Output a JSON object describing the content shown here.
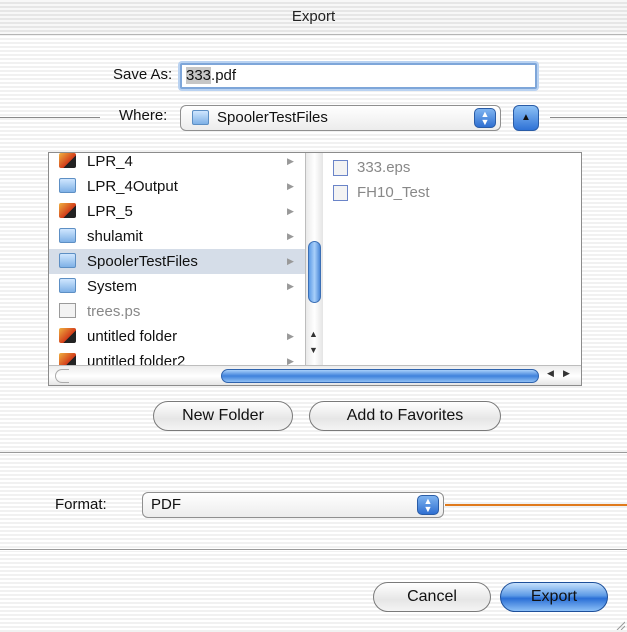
{
  "window": {
    "title": "Export"
  },
  "save_as": {
    "label": "Save As:",
    "value_selected": "333",
    "value_rest": ".pdf"
  },
  "where": {
    "label": "Where:",
    "selected": "SpoolerTestFiles"
  },
  "browser": {
    "column1": [
      {
        "name": "LPR_4",
        "icon": "red-folder-icon",
        "has_children": true,
        "selected": false,
        "dimmed": false
      },
      {
        "name": "LPR_4Output",
        "icon": "blue-folder-icon",
        "has_children": true,
        "selected": false,
        "dimmed": false
      },
      {
        "name": "LPR_5",
        "icon": "red-folder-icon",
        "has_children": true,
        "selected": false,
        "dimmed": false
      },
      {
        "name": "shulamit",
        "icon": "blue-folder-icon",
        "has_children": true,
        "selected": false,
        "dimmed": false
      },
      {
        "name": "SpoolerTestFiles",
        "icon": "blue-folder-icon",
        "has_children": true,
        "selected": true,
        "dimmed": false
      },
      {
        "name": "System",
        "icon": "blue-folder-icon",
        "has_children": true,
        "selected": false,
        "dimmed": false
      },
      {
        "name": "trees.ps",
        "icon": "document-icon",
        "has_children": false,
        "selected": false,
        "dimmed": true
      },
      {
        "name": "untitled folder",
        "icon": "red-folder-icon",
        "has_children": true,
        "selected": false,
        "dimmed": false
      },
      {
        "name": "untitled folder2",
        "icon": "red-folder-icon",
        "has_children": true,
        "selected": false,
        "dimmed": false
      }
    ],
    "column2": [
      {
        "name": "333.eps",
        "icon": "eps-file-icon"
      },
      {
        "name": "FH10_Test",
        "icon": "alias-file-icon"
      }
    ]
  },
  "buttons": {
    "new_folder": "New Folder",
    "add_to_favorites": "Add to Favorites",
    "cancel": "Cancel",
    "export": "Export"
  },
  "format": {
    "label": "Format:",
    "selected": "PDF"
  },
  "colors": {
    "accent": "#2f72d6",
    "selection": "#d5dde8",
    "callout": "#e07a1c"
  }
}
